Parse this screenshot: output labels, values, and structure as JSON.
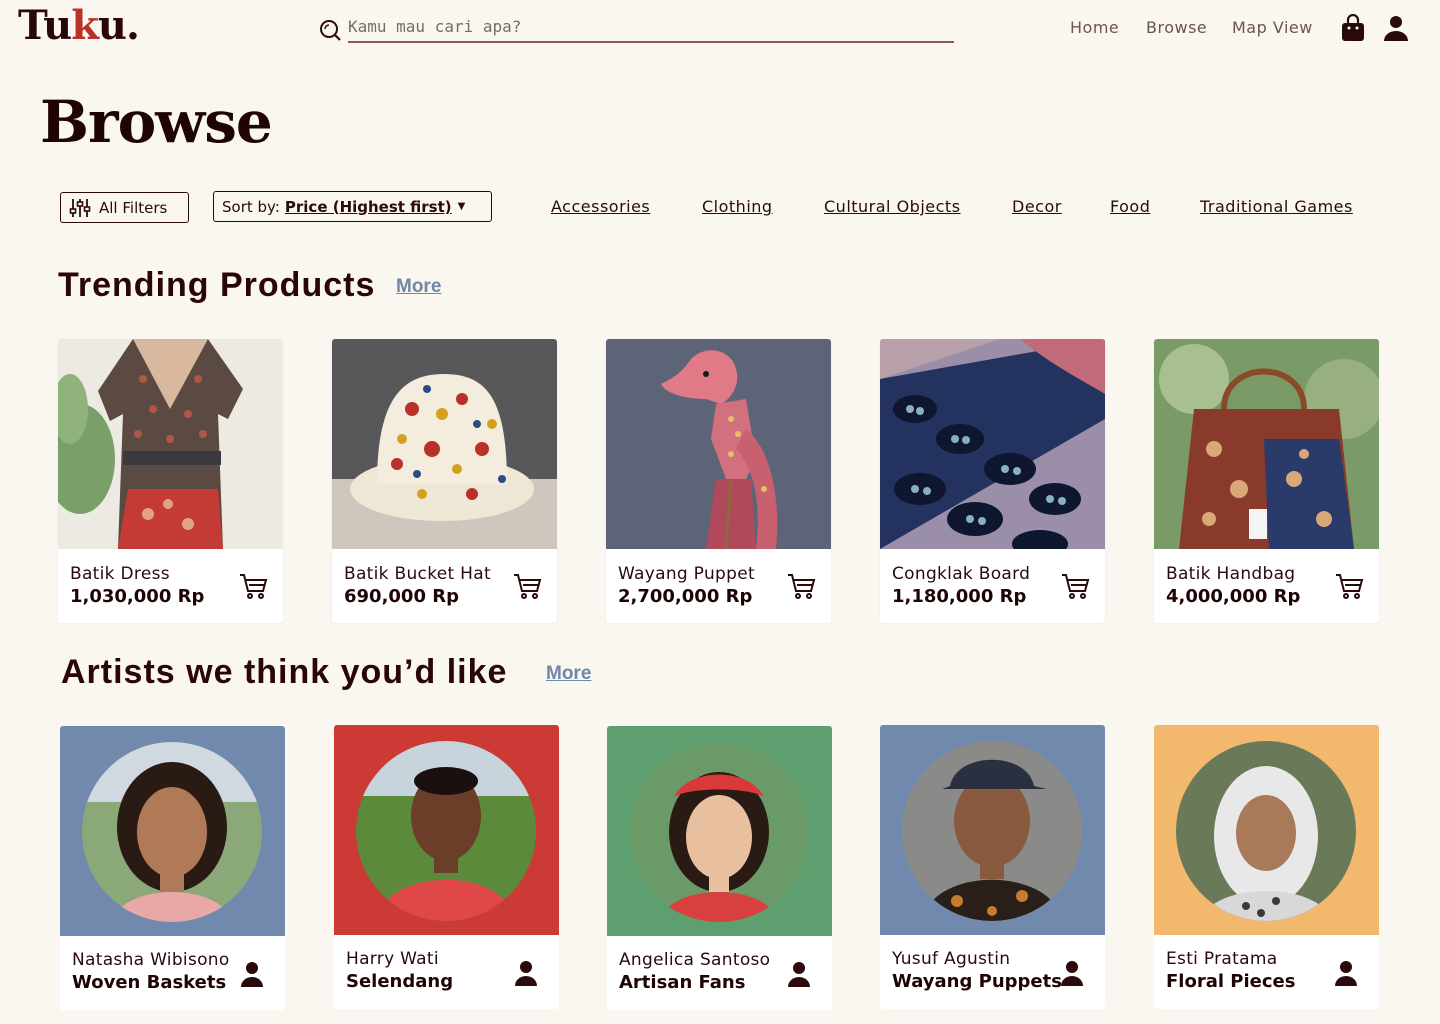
{
  "header": {
    "logo_prefix": "Tu",
    "logo_accent": "k",
    "logo_suffix": "u.",
    "search_placeholder": "Kamu mau cari apa?",
    "nav": {
      "home": "Home",
      "browse": "Browse",
      "map": "Map View"
    }
  },
  "page_title": "Browse",
  "filters": {
    "all_filters": "All Filters",
    "sort_label": "Sort by:",
    "sort_value": "Price (Highest first)",
    "categories": [
      "Accessories",
      "Clothing",
      "Cultural Objects",
      "Decor",
      "Food",
      "Traditional Games"
    ]
  },
  "trending": {
    "title": "Trending Products",
    "more": "More",
    "products": [
      {
        "name": "Batik Dress",
        "price": "1,030,000 Rp"
      },
      {
        "name": "Batik Bucket Hat",
        "price": "690,000 Rp"
      },
      {
        "name": "Wayang Puppet",
        "price": "2,700,000 Rp"
      },
      {
        "name": "Congklak Board",
        "price": "1,180,000 Rp"
      },
      {
        "name": "Batik Handbag",
        "price": "4,000,000 Rp"
      }
    ]
  },
  "artists": {
    "title": "Artists we think you’d like",
    "more": "More",
    "items": [
      {
        "name": "Natasha Wibisono",
        "craft": "Woven Baskets",
        "color": "#7189ac"
      },
      {
        "name": "Harry Wati",
        "craft": "Selendang",
        "color": "#cc3a36"
      },
      {
        "name": "Angelica Santoso",
        "craft": "Artisan Fans",
        "color": "#5e9f70"
      },
      {
        "name": "Yusuf Agustin",
        "craft": "Wayang Puppets",
        "color": "#7189ac"
      },
      {
        "name": "Esti Pratama",
        "craft": "Floral Pieces",
        "color": "#f2b86e"
      }
    ]
  },
  "colors": {
    "background": "#faf7f0",
    "brand_dark": "#2a0606",
    "brand_accent": "#b8322a",
    "link_blue": "#7088a8"
  }
}
